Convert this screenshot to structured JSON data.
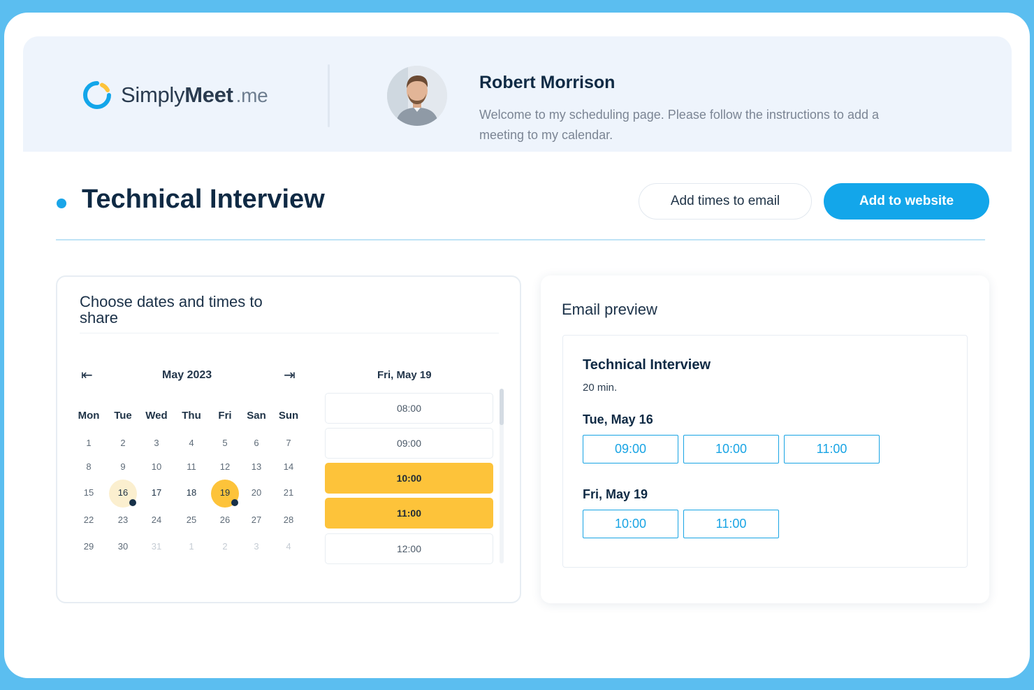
{
  "brand": {
    "name_light": "Simply",
    "name_bold": "Meet",
    "name_suffix": ".me",
    "accent": "#13a6ea",
    "ring_colors": [
      "#13a6ea",
      "#fdc33a"
    ]
  },
  "profile": {
    "name": "Robert Morrison",
    "description": "Welcome to my scheduling page. Please follow the instructions to add a meeting to my calendar."
  },
  "page": {
    "title": "Technical Interview",
    "btn_email": "Add times to email",
    "btn_website": "Add to website"
  },
  "picker": {
    "title": "Choose dates and times to share",
    "prev_icon": "arrow-left-icon",
    "next_icon": "arrow-right-icon",
    "month": "May 2023",
    "weekdays": [
      "Mon",
      "Tue",
      "Wed",
      "Thu",
      "Fri",
      "San",
      "Sun"
    ],
    "weeks": [
      [
        "1",
        "2",
        "3",
        "4",
        "5",
        "6",
        "7"
      ],
      [
        "8",
        "9",
        "10",
        "11",
        "12",
        "13",
        "14"
      ],
      [
        "15",
        "16",
        "17",
        "18",
        "19",
        "20",
        "21"
      ],
      [
        "22",
        "23",
        "24",
        "25",
        "26",
        "27",
        "28"
      ],
      [
        "29",
        "30",
        "31",
        "1",
        "2",
        "3",
        "4"
      ]
    ],
    "selected_date": "Fri, May 19",
    "slots": [
      {
        "time": "08:00",
        "selected": false
      },
      {
        "time": "09:00",
        "selected": false
      },
      {
        "time": "10:00",
        "selected": true
      },
      {
        "time": "11:00",
        "selected": true
      },
      {
        "time": "12:00",
        "selected": false
      }
    ]
  },
  "preview": {
    "label": "Email preview",
    "title": "Technical Interview",
    "duration": "20 min.",
    "days": [
      {
        "label": "Tue, May 16",
        "times": [
          "09:00",
          "10:00",
          "11:00"
        ]
      },
      {
        "label": "Fri, May 19",
        "times": [
          "10:00",
          "11:00"
        ]
      }
    ]
  },
  "colors": {
    "highlight_yellow": "#fdc33a",
    "highlight_pale": "#fbefcf",
    "badge_dark": "#173049"
  }
}
